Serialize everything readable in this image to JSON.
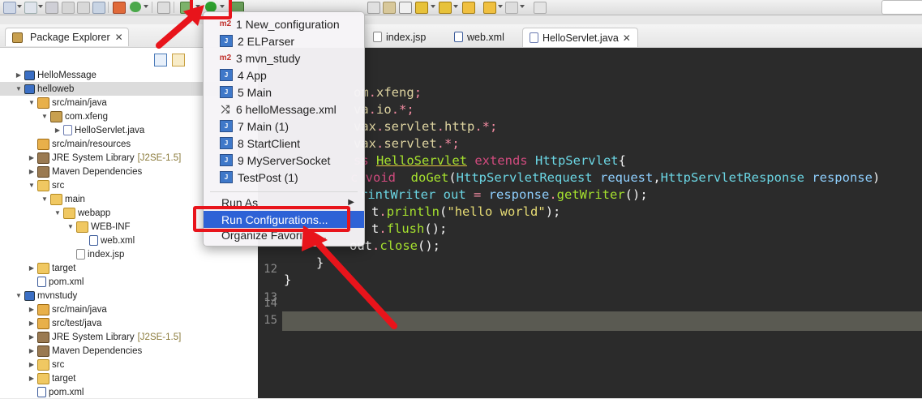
{
  "toolbar": {
    "search_placeholder": ""
  },
  "package_explorer": {
    "tab_label": "Package Explorer",
    "close_glyph": "✕",
    "tree": [
      {
        "label": "HelloMessage",
        "indent": 0,
        "twisty": "▶",
        "icon": "project",
        "decor": ""
      },
      {
        "label": "helloweb",
        "indent": 0,
        "twisty": "▼",
        "icon": "project",
        "decor": "",
        "selected": true
      },
      {
        "label": "src/main/java",
        "indent": 1,
        "twisty": "▼",
        "icon": "srcfolder",
        "decor": ""
      },
      {
        "label": "com.xfeng",
        "indent": 2,
        "twisty": "▼",
        "icon": "package",
        "decor": ""
      },
      {
        "label": "HelloServlet.java",
        "indent": 3,
        "twisty": "▶",
        "icon": "java",
        "decor": ""
      },
      {
        "label": "src/main/resources",
        "indent": 1,
        "twisty": "",
        "icon": "srcfolder",
        "decor": ""
      },
      {
        "label": "JRE System Library",
        "indent": 1,
        "twisty": "▶",
        "icon": "library",
        "decor": "[J2SE-1.5]"
      },
      {
        "label": "Maven Dependencies",
        "indent": 1,
        "twisty": "▶",
        "icon": "library",
        "decor": ""
      },
      {
        "label": "src",
        "indent": 1,
        "twisty": "▼",
        "icon": "folder",
        "decor": ""
      },
      {
        "label": "main",
        "indent": 2,
        "twisty": "▼",
        "icon": "folder",
        "decor": ""
      },
      {
        "label": "webapp",
        "indent": 3,
        "twisty": "▼",
        "icon": "folder",
        "decor": ""
      },
      {
        "label": "WEB-INF",
        "indent": 4,
        "twisty": "▼",
        "icon": "folder",
        "decor": ""
      },
      {
        "label": "web.xml",
        "indent": 5,
        "twisty": "",
        "icon": "xml",
        "decor": ""
      },
      {
        "label": "index.jsp",
        "indent": 4,
        "twisty": "",
        "icon": "file",
        "decor": ""
      },
      {
        "label": "target",
        "indent": 1,
        "twisty": "▶",
        "icon": "folder",
        "decor": ""
      },
      {
        "label": "pom.xml",
        "indent": 1,
        "twisty": "",
        "icon": "xml",
        "decor": ""
      },
      {
        "label": "mvnstudy",
        "indent": 0,
        "twisty": "▼",
        "icon": "project",
        "decor": ""
      },
      {
        "label": "src/main/java",
        "indent": 1,
        "twisty": "▶",
        "icon": "srcfolder",
        "decor": ""
      },
      {
        "label": "src/test/java",
        "indent": 1,
        "twisty": "▶",
        "icon": "srcfolder",
        "decor": ""
      },
      {
        "label": "JRE System Library",
        "indent": 1,
        "twisty": "▶",
        "icon": "library",
        "decor": "[J2SE-1.5]"
      },
      {
        "label": "Maven Dependencies",
        "indent": 1,
        "twisty": "▶",
        "icon": "library",
        "decor": ""
      },
      {
        "label": "src",
        "indent": 1,
        "twisty": "▶",
        "icon": "folder",
        "decor": ""
      },
      {
        "label": "target",
        "indent": 1,
        "twisty": "▶",
        "icon": "folder",
        "decor": ""
      },
      {
        "label": "pom.xml",
        "indent": 1,
        "twisty": "",
        "icon": "xml",
        "decor": ""
      }
    ]
  },
  "editor": {
    "tabs": [
      {
        "label": "index.jsp",
        "icon": "file",
        "active": false
      },
      {
        "label": "web.xml",
        "icon": "xml",
        "active": false
      },
      {
        "label": "HelloServlet.java",
        "icon": "java",
        "active": true,
        "close": "✕"
      }
    ],
    "line_numbers": [
      "12",
      "13",
      "14",
      "15"
    ],
    "code_fragments": {
      "l4a": "om",
      "l4b": ".",
      "l4c": "xfeng",
      "l4d": ";",
      "l5a": "va",
      "l5b": ".",
      "l5c": "io",
      "l5d": ".*;",
      "l6a": "vax",
      "l6b": ".",
      "l6c": "servlet",
      "l6d": ".",
      "l6e": "http",
      "l6f": ".*;",
      "l7a": "vax",
      "l7b": ".",
      "l7c": "servlet",
      "l7d": ".*;",
      "l8a": "ss ",
      "l8b": "HelloServlet",
      "l8c": " extends ",
      "l8d": "HttpServlet",
      "l8e": "{",
      "l9a": "c void  ",
      "l9b": "doGet",
      "l9c": "(",
      "l9d": "HttpServletRequest",
      "l9e": " request",
      "l9f": ",",
      "l9g": "HttpServletResponse",
      "l9h": " response",
      "l9i": ")",
      "l10a": "rintWriter out ",
      "l10b": "=",
      "l10c": " response",
      "l10d": ".",
      "l10e": "getWriter",
      "l10f": "();",
      "l11a": "t",
      "l11b": ".",
      "l11c": "println",
      "l11d": "(",
      "l11e": "\"hello world\"",
      "l11f": ");",
      "l12a": "t",
      "l12b": ".",
      "l12c": "flush",
      "l12d": "();",
      "l13a": "out",
      "l13b": ".",
      "l13c": "close",
      "l13d": "();",
      "l14": "}",
      "l15": "}"
    }
  },
  "run_menu": {
    "items": [
      {
        "label": "1 New_configuration",
        "icon": "m2-icon",
        "glyph": "m2"
      },
      {
        "label": "2 ELParser",
        "icon": "java-app-icon",
        "glyph": "J"
      },
      {
        "label": "3 mvn_study",
        "icon": "m2-icon",
        "glyph": "m2"
      },
      {
        "label": "4 App",
        "icon": "java-app-icon",
        "glyph": "J"
      },
      {
        "label": "5 Main",
        "icon": "java-app-icon",
        "glyph": "J"
      },
      {
        "label": "6 helloMessage.xml",
        "icon": "xml-run-icon",
        "glyph": "⤭"
      },
      {
        "label": "7 Main (1)",
        "icon": "java-app-icon",
        "glyph": "J"
      },
      {
        "label": "8 StartClient",
        "icon": "java-app-icon",
        "glyph": "J"
      },
      {
        "label": "9 MyServerSocket",
        "icon": "java-app-icon",
        "glyph": "J"
      },
      {
        "label": "TestPost (1)",
        "icon": "java-app-icon",
        "glyph": "J"
      }
    ],
    "run_as": "Run As",
    "submenu_arrow": "▶",
    "run_configurations": "Run Configurations...",
    "organize_favorites": "Organize Favorites..."
  },
  "colors": {
    "annotation_red": "#e8141b",
    "menu_highlight": "#2e62d6",
    "editor_bg": "#2b2b2b"
  }
}
